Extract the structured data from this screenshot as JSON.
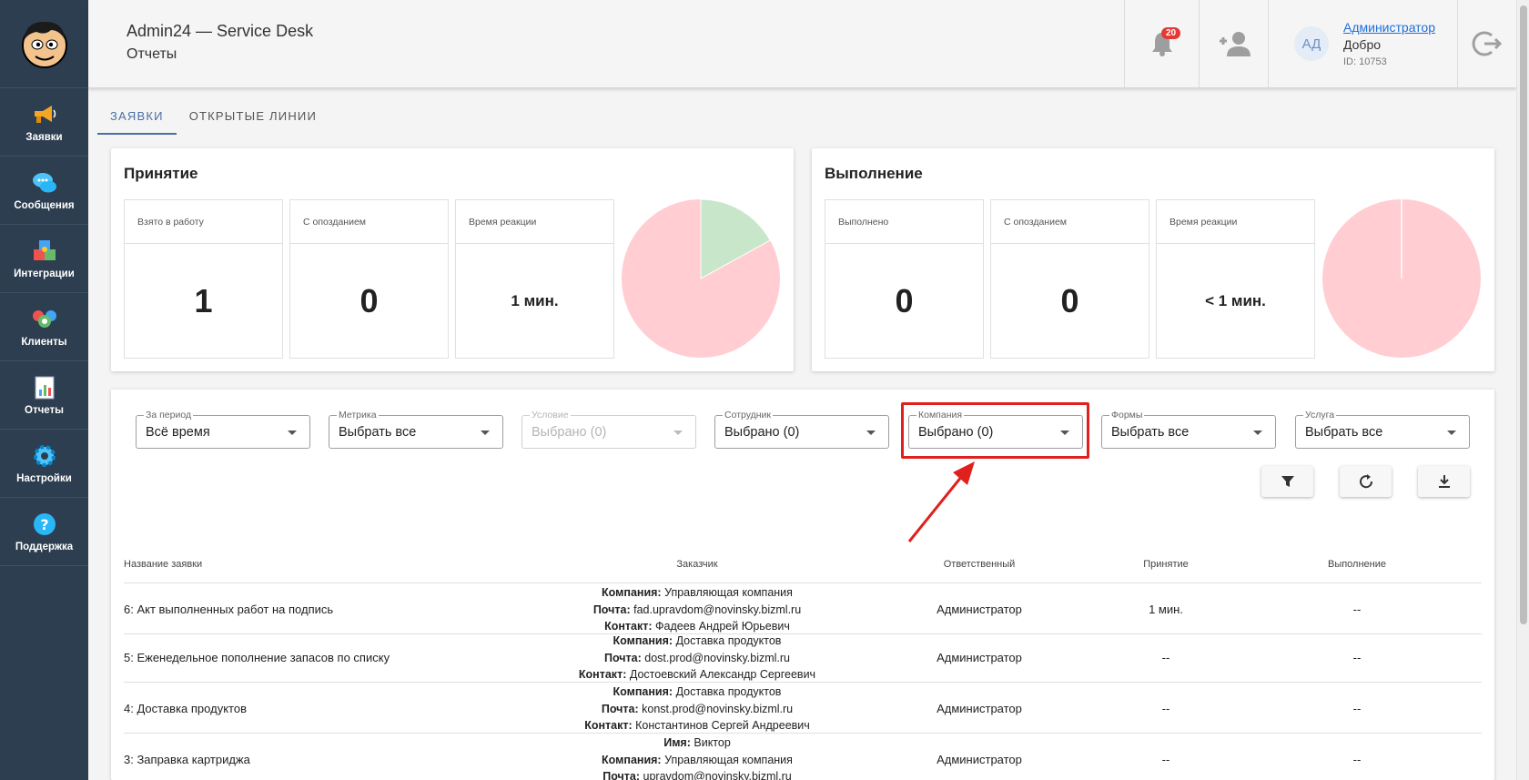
{
  "header": {
    "app_title": "Admin24 — Service Desk",
    "page_title": "Отчеты",
    "notifications_count": "20",
    "user": {
      "initials": "АД",
      "name": "Администратор",
      "greeting": "Добро",
      "id": "ID: 10753"
    }
  },
  "sidebar": {
    "items": [
      {
        "label": "Заявки",
        "icon": "megaphone-icon"
      },
      {
        "label": "Сообщения",
        "icon": "chat-bubbles-icon"
      },
      {
        "label": "Интеграции",
        "icon": "puzzle-icon"
      },
      {
        "label": "Клиенты",
        "icon": "people-icon"
      },
      {
        "label": "Отчеты",
        "icon": "report-icon"
      },
      {
        "label": "Настройки",
        "icon": "gear-icon"
      },
      {
        "label": "Поддержка",
        "icon": "help-icon"
      }
    ]
  },
  "tabs": [
    "ЗАЯВКИ",
    "ОТКРЫТЫЕ ЛИНИИ"
  ],
  "acceptance": {
    "title": "Принятие",
    "stats": [
      {
        "label": "Взято в работу",
        "value": "1"
      },
      {
        "label": "С опозданием",
        "value": "0"
      },
      {
        "label": "Время реакции",
        "value": "1 мин."
      }
    ],
    "pie_fraction_green": 0.17
  },
  "completion": {
    "title": "Выполнение",
    "stats": [
      {
        "label": "Выполнено",
        "value": "0"
      },
      {
        "label": "С опозданием",
        "value": "0"
      },
      {
        "label": "Время реакции",
        "value": "< 1 мин."
      }
    ],
    "pie_fraction_green": 0.0
  },
  "colors": {
    "pie_pink": "#ffcdd2",
    "pie_green": "#c8e6c9",
    "highlight": "#e0201d",
    "sidebar": "#2d3e50"
  },
  "filters": [
    {
      "label": "За период",
      "value": "Всё время"
    },
    {
      "label": "Метрика",
      "value": "Выбрать все"
    },
    {
      "label": "Условие",
      "value": "Выбрано (0)"
    },
    {
      "label": "Сотрудник",
      "value": "Выбрано (0)"
    },
    {
      "label": "Компания",
      "value": "Выбрано (0)"
    },
    {
      "label": "Формы",
      "value": "Выбрать все"
    },
    {
      "label": "Услуга",
      "value": "Выбрать все"
    }
  ],
  "table": {
    "headers": [
      "Название заявки",
      "Заказчик",
      "Ответственный",
      "Принятие",
      "Выполнение"
    ],
    "rows": [
      {
        "name": "6: Акт выполненных работ на подпись",
        "customer": [
          [
            "Компания:",
            "Управляющая компания"
          ],
          [
            "Почта:",
            "fad.upravdom@novinsky.bizml.ru"
          ],
          [
            "Контакт:",
            "Фадеев Андрей Юрьевич"
          ]
        ],
        "responsible": "Администратор",
        "accept": "1 мин.",
        "complete": "--"
      },
      {
        "name": "5: Еженедельное пополнение запасов по списку",
        "customer": [
          [
            "Компания:",
            "Доставка продуктов"
          ],
          [
            "Почта:",
            "dost.prod@novinsky.bizml.ru"
          ],
          [
            "Контакт:",
            "Достоевский Александр Сергеевич"
          ]
        ],
        "responsible": "Администратор",
        "accept": "--",
        "complete": "--"
      },
      {
        "name": "4: Доставка продуктов",
        "customer": [
          [
            "Компания:",
            "Доставка продуктов"
          ],
          [
            "Почта:",
            "konst.prod@novinsky.bizml.ru"
          ],
          [
            "Контакт:",
            "Константинов Сергей Андреевич"
          ]
        ],
        "responsible": "Администратор",
        "accept": "--",
        "complete": "--"
      },
      {
        "name": "3: Заправка картриджа",
        "customer": [
          [
            "Имя:",
            "Виктор"
          ],
          [
            "Компания:",
            "Управляющая компания"
          ],
          [
            "Почта:",
            "upravdom@novinsky.bizml.ru"
          ]
        ],
        "responsible": "Администратор",
        "accept": "--",
        "complete": "--"
      }
    ]
  }
}
